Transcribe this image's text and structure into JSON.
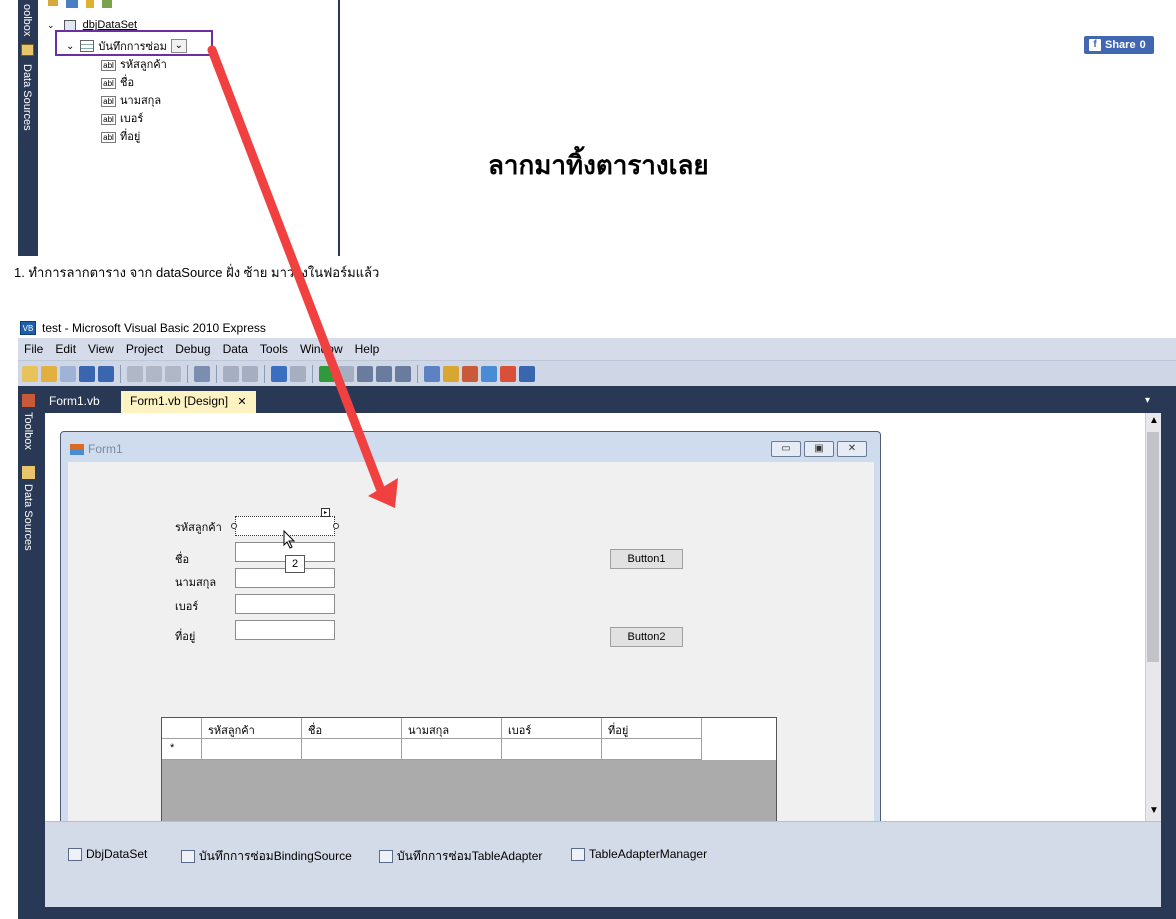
{
  "top_panel": {
    "vtab_toolbox": "oolbox",
    "vtab_data_sources": "Data Sources",
    "tree_root": "dbjDataSet",
    "tree_table": "บันทึกการซ่อม",
    "tree_fields": [
      "รหัสลูกค้า",
      "ชื่อ",
      "นามสกุล",
      "เบอร์",
      "ที่อยู่"
    ],
    "field_icon_text": "abl"
  },
  "fb_share": {
    "label": "Share",
    "count": "0"
  },
  "big_caption": "ลากมาทิ้งตารางเลย",
  "step_caption": "1. ทำการลากตาราง จาก dataSource ฝั่ง ซ้าย มาวางในฟอร์มแล้ว",
  "vs_window": {
    "title": "test - Microsoft Visual Basic 2010 Express",
    "menu": [
      "File",
      "Edit",
      "View",
      "Project",
      "Debug",
      "Data",
      "Tools",
      "Window",
      "Help"
    ],
    "side_tabs": [
      "Toolbox",
      "Data Sources"
    ],
    "doc_tabs": [
      {
        "label": "Form1.vb",
        "active": false
      },
      {
        "label": "Form1.vb [Design]",
        "active": true
      }
    ],
    "tab_close": "✕"
  },
  "form1": {
    "title": "Form1",
    "labels": [
      "รหัสลูกค้า",
      "ชื่อ",
      "นามสกุล",
      "เบอร์",
      "ที่อยู่"
    ],
    "button1": "Button1",
    "button2": "Button2",
    "tooltip": "2",
    "grid_columns": [
      "รหัสลูกค้า",
      "ชื่อ",
      "นามสกุล",
      "เบอร์",
      "ที่อยู่"
    ],
    "new_row_marker": "*"
  },
  "tray": [
    "DbjDataSet",
    "บันทึกการซ่อมBindingSource",
    "บันทึกการซ่อมTableAdapter",
    "TableAdapterManager"
  ],
  "colors": {
    "arrow": "#f04040",
    "highlight": "#6b2fa3",
    "vs_dark": "#293955"
  }
}
